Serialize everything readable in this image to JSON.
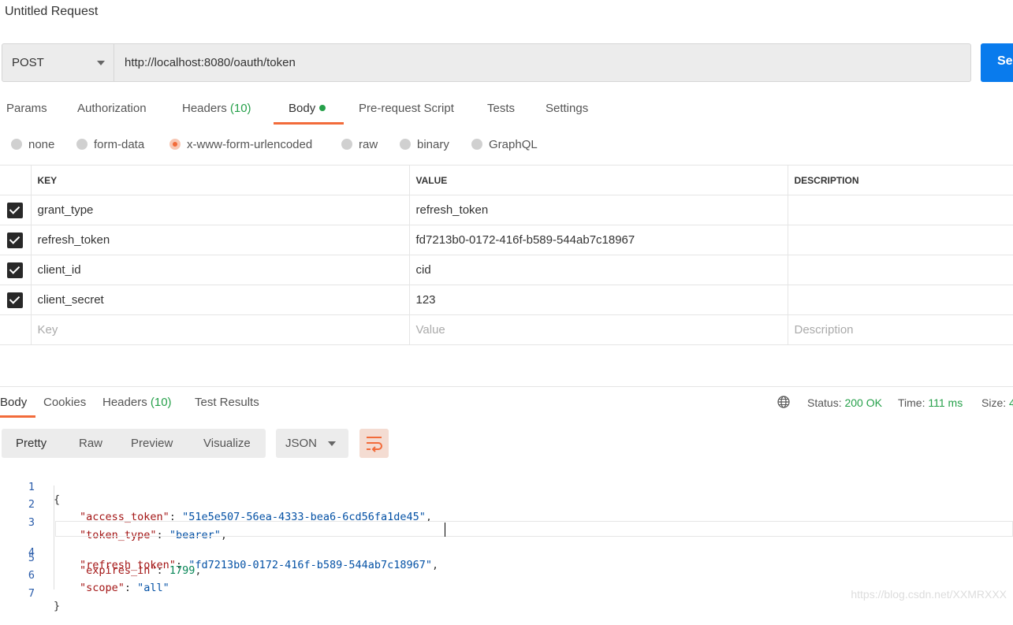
{
  "title": "Untitled Request",
  "request": {
    "method": "POST",
    "url": "http://localhost:8080/oauth/token",
    "send_label": "Se"
  },
  "request_tabs": {
    "params": "Params",
    "authorization": "Authorization",
    "headers": "Headers",
    "headers_count": "(10)",
    "body": "Body",
    "prerequest": "Pre-request Script",
    "tests": "Tests",
    "settings": "Settings"
  },
  "body_types": {
    "none": "none",
    "form_data": "form-data",
    "urlencoded": "x-www-form-urlencoded",
    "raw": "raw",
    "binary": "binary",
    "graphql": "GraphQL",
    "selected": "x-www-form-urlencoded"
  },
  "params_table": {
    "headers": [
      "KEY",
      "VALUE",
      "DESCRIPTION"
    ],
    "rows": [
      {
        "key": "grant_type",
        "value": "refresh_token",
        "description": ""
      },
      {
        "key": "refresh_token",
        "value": "fd7213b0-0172-416f-b589-544ab7c18967",
        "description": ""
      },
      {
        "key": "client_id",
        "value": "cid",
        "description": ""
      },
      {
        "key": "client_secret",
        "value": "123",
        "description": ""
      }
    ],
    "placeholder": {
      "key": "Key",
      "value": "Value",
      "description": "Description"
    }
  },
  "response_tabs": {
    "body": "Body",
    "cookies": "Cookies",
    "headers": "Headers",
    "headers_count": "(10)",
    "test_results": "Test Results"
  },
  "response_status": {
    "status_label": "Status:",
    "status_value": "200 OK",
    "time_label": "Time:",
    "time_value": "111 ms",
    "size_label": "Size:",
    "size_value": "4"
  },
  "view_modes": {
    "pretty": "Pretty",
    "raw": "Raw",
    "preview": "Preview",
    "visualize": "Visualize",
    "format": "JSON"
  },
  "response_body": {
    "line_numbers": [
      "1",
      "2",
      "3",
      "4",
      "5",
      "6",
      "7"
    ],
    "open_brace": "{",
    "close_brace": "}",
    "fields": [
      {
        "key": "\"access_token\"",
        "value": "\"51e5e507-56ea-4333-bea6-6cd56fa1de45\"",
        "kind": "string",
        "comma": ","
      },
      {
        "key": "\"token_type\"",
        "value": "\"bearer\"",
        "kind": "string",
        "comma": ","
      },
      {
        "key": "\"refresh_token\"",
        "value": "\"fd7213b0-0172-416f-b589-544ab7c18967\"",
        "kind": "string",
        "comma": ","
      },
      {
        "key": "\"expires_in\"",
        "value": "1799",
        "kind": "number",
        "comma": ","
      },
      {
        "key": "\"scope\"",
        "value": "\"all\"",
        "kind": "string",
        "comma": ""
      }
    ]
  },
  "watermark": "https://blog.csdn.net/XXMRXXX",
  "colors": {
    "accent": "#f26b3a",
    "send": "#097bed",
    "ok": "#26a04a"
  }
}
